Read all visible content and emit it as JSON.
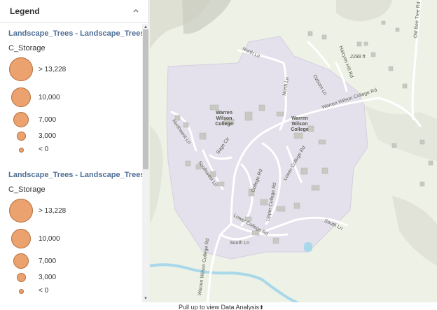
{
  "legend": {
    "title": "Legend",
    "collapse_icon": "chevron-up-icon",
    "layers": [
      {
        "title": "Landscape_Trees - Landscape_Trees",
        "field": "C_Storage",
        "classes": [
          {
            "label": "> 13,228"
          },
          {
            "label": "10,000"
          },
          {
            "label": "7,000"
          },
          {
            "label": "3,000"
          },
          {
            "label": "< 0"
          }
        ]
      },
      {
        "title": "Landscape_Trees - Landscape_Trees",
        "field": "C_Storage",
        "classes": [
          {
            "label": "> 13,228"
          },
          {
            "label": "10,000"
          },
          {
            "label": "7,000"
          },
          {
            "label": "3,000"
          },
          {
            "label": "< 0"
          }
        ]
      }
    ],
    "symbol_color": "#eba26e"
  },
  "map": {
    "labels": {
      "north_ln_1": "North Ln",
      "north_ln_2": "North Ln",
      "halcyon_hill_rd": "Halcyon Hill Rd",
      "old_bee_tree_rd": "Old Bee Tree Rd",
      "elevation": "2288 ft",
      "warren_wilson_college_rd_1": "Warren Wilson College Rd",
      "warren_wilson_college_rd_2": "Warren Wilson College Rd",
      "ozborn_ln": "Ozborn Ln",
      "campus_1": "Warren Wilson College",
      "campus_2": "Warren Wilson College",
      "northwest_ln": "Northwest Ln",
      "sage_cir": "Sage Cir",
      "southwest_ln": "Southwest Ln",
      "college_rd": "College Rd",
      "lower_college_rd": "Lower College Rd",
      "upper_college_rd": "Upper College Rd",
      "lower_college_rd_2": "Lower College Rd",
      "south_ln_1": "South Ln",
      "south_ln_2": "South Ln"
    }
  },
  "footer": {
    "pullup_text": "Pull up to view Data Analysis",
    "pullup_icon": "arrow-up-icon"
  }
}
